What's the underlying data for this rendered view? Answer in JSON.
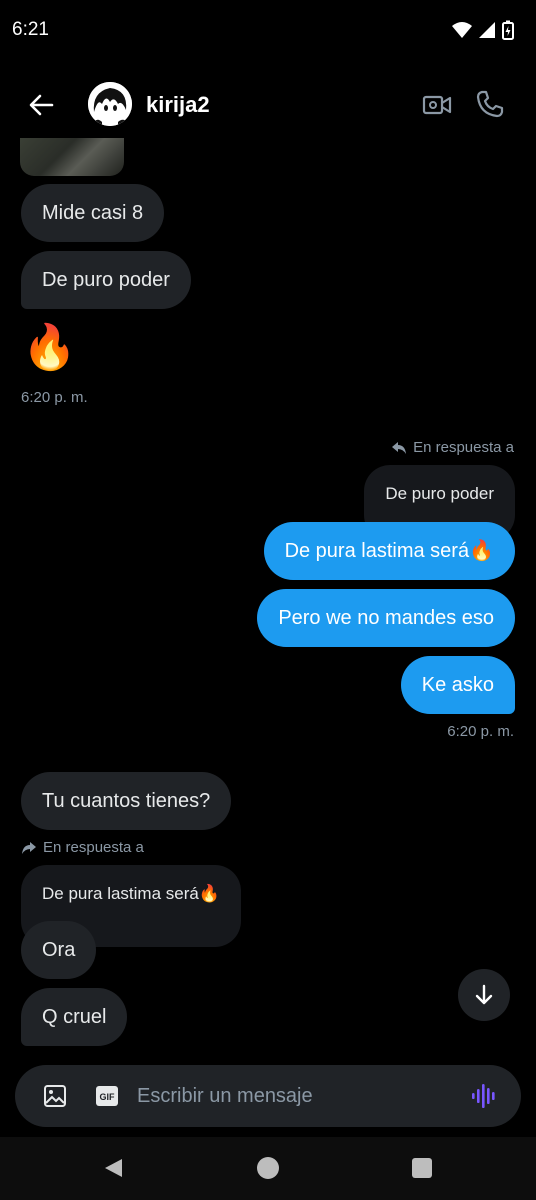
{
  "status_bar": {
    "time": "6:21"
  },
  "header": {
    "username": "kirija2"
  },
  "messages": {
    "m1": "Mide casi 8",
    "m2": "De puro poder",
    "emoji": "🔥",
    "time1": "6:20 p. m.",
    "reply_label_1": "En respuesta a",
    "quoted_1": "De puro poder",
    "o1": "De pura lastima será🔥",
    "o2": "Pero we no mandes eso",
    "o3": "Ke asko",
    "time2": "6:20 p. m.",
    "m3": "Tu cuantos tienes?",
    "reply_label_2": "En respuesta a",
    "quoted_2": "De pura lastima será🔥",
    "m4": "Ora",
    "m5": "Q cruel"
  },
  "composer": {
    "placeholder": "Escribir un mensaje"
  },
  "colors": {
    "accent": "#1d9bf0",
    "incoming": "#202327",
    "voice": "#7856ff"
  },
  "icons": [
    "back-arrow-icon",
    "video-call-icon",
    "phone-icon",
    "reply-arrow-icon",
    "image-icon",
    "gif-icon",
    "voice-icon",
    "arrow-down-icon"
  ]
}
